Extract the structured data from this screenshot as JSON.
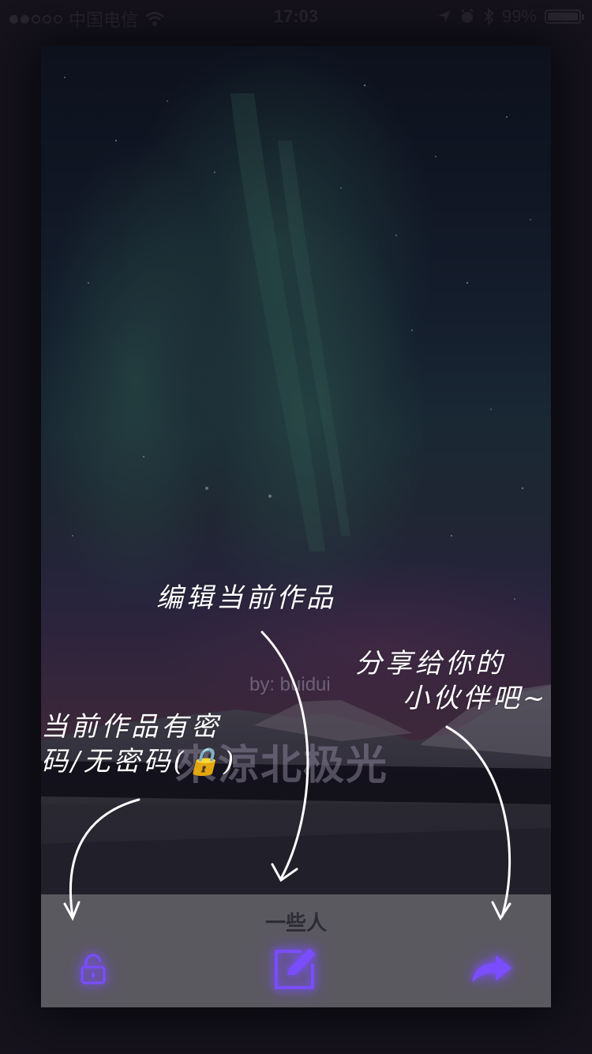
{
  "status_bar": {
    "carrier": "中国电信",
    "time": "17:03",
    "battery": "99%",
    "battery_level": 0.99,
    "signal_bars_filled": 2,
    "signal_bars_total": 5,
    "icons": [
      "wifi-icon",
      "location-icon",
      "alarm-icon",
      "bluetooth-icon"
    ]
  },
  "post": {
    "byline": "by: buidui",
    "title": "來涼北极光",
    "author": "一些人"
  },
  "toolbar": {
    "lock_icon": "lock-icon",
    "edit_icon": "edit-icon",
    "share_icon": "share-icon",
    "accent_color": "#7a4dff"
  },
  "annotations": {
    "edit": "编辑当前作品",
    "share_line1": "分享给你的",
    "share_line2": "小伙伴吧~",
    "lock_line1": "当前作品有密",
    "lock_line2": "码/无密码(🔒)"
  }
}
